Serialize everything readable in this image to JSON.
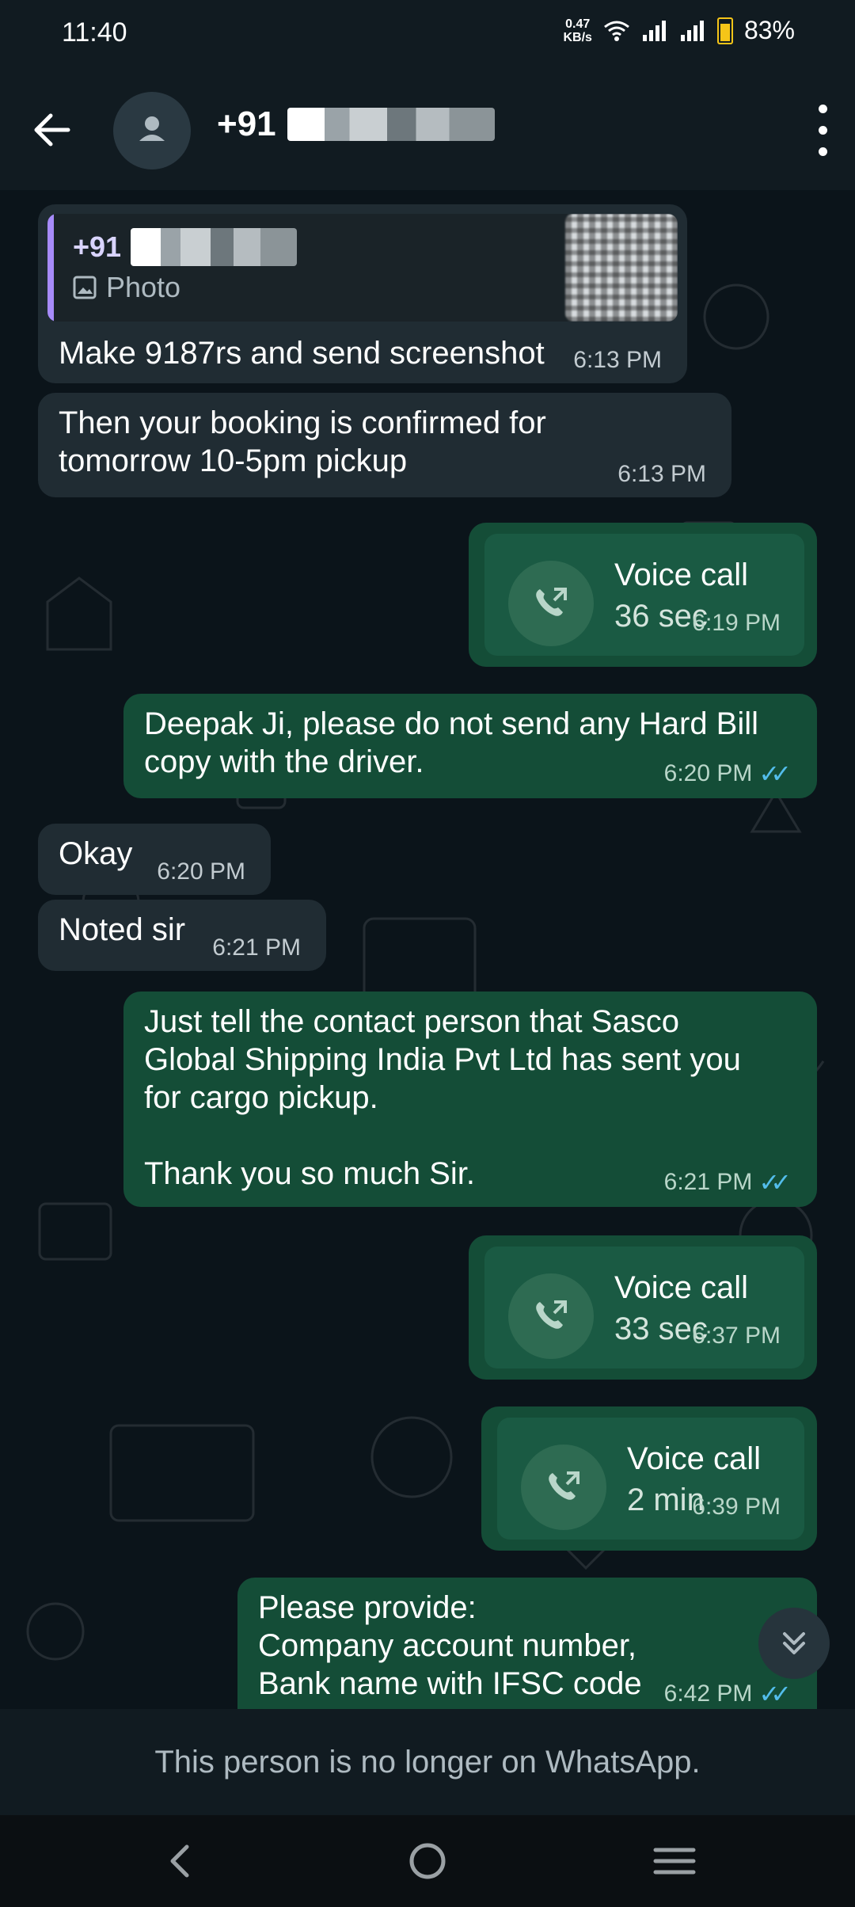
{
  "status_bar": {
    "time": "11:40",
    "net_speed_value": "0.47",
    "net_speed_unit": "KB/s",
    "battery": "83%"
  },
  "header": {
    "contact_prefix": "+91"
  },
  "messages": {
    "m1": {
      "quote_name": "+91",
      "quote_type": "Photo",
      "text": "Make 9187rs and send screenshot",
      "time": "6:13 PM"
    },
    "m2": {
      "text": "Then your booking is confirmed for\ntomorrow 10-5pm pickup",
      "time": "6:13 PM"
    },
    "m3": {
      "title": "Voice call",
      "duration": "36 sec",
      "time": "6:19 PM"
    },
    "m4": {
      "text": "Deepak Ji, please do not send any Hard Bill\ncopy with the driver.",
      "time": "6:20 PM"
    },
    "m5": {
      "text": "Okay",
      "time": "6:20 PM"
    },
    "m6": {
      "text": "Noted sir",
      "time": "6:21 PM"
    },
    "m7": {
      "text": "Just tell the contact person that Sasco\nGlobal Shipping India Pvt Ltd has sent you\nfor cargo pickup.\n\nThank you so much Sir.",
      "time": "6:21 PM"
    },
    "m8": {
      "title": "Voice call",
      "duration": "33 sec",
      "time": "6:37 PM"
    },
    "m9": {
      "title": "Voice call",
      "duration": "2 min",
      "time": "6:39 PM"
    },
    "m10": {
      "text": "Please provide:\nCompany account number,\nBank name with IFSC code",
      "time": "6:42 PM"
    }
  },
  "footer": {
    "notice": "This person is no longer on WhatsApp."
  },
  "icons": {
    "back": "arrow-left-icon",
    "avatar": "person-icon",
    "menu": "more-vert-icon",
    "call": "outgoing-call-icon",
    "photo": "image-icon",
    "ticks": "double-check-icon",
    "scroll": "double-chevron-down-icon",
    "nav_back": "chevron-left-icon",
    "nav_home": "circle-icon",
    "nav_recents": "menu-lines-icon"
  },
  "colors": {
    "incoming": "#202c33",
    "outgoing": "#144d37",
    "read_ticks": "#53bdeb",
    "header": "#111b21"
  }
}
